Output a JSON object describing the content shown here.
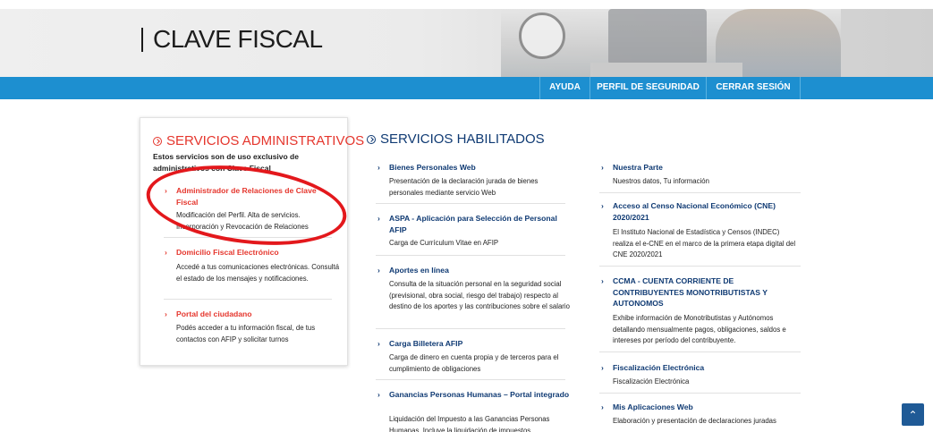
{
  "header": {
    "title": "CLAVE FISCAL"
  },
  "nav": {
    "items": [
      "AYUDA",
      "PERFIL DE SEGURIDAD",
      "CERRAR SESIÓN"
    ]
  },
  "admin": {
    "title": "SERVICIOS ADMINISTRATIVOS",
    "description": "Estos servicios son de uso exclusivo de administrativos con Clave Fiscal",
    "items": [
      {
        "title": "Administrador de Relaciones de Clave Fiscal",
        "desc": "Modificación del Perfil. Alta de servicios. Incorporación y Revocación de Relaciones"
      },
      {
        "title": "Domicilio Fiscal Electrónico",
        "desc": "Accedé a tus comunicaciones electrónicas. Consultá el estado de los mensajes y notificaciones."
      },
      {
        "title": "Portal del ciudadano",
        "desc": "Podés acceder a tu información fiscal, de tus contactos con AFIP y solicitar turnos"
      }
    ]
  },
  "habilitados": {
    "title": "SERVICIOS HABILITADOS",
    "col1": [
      {
        "title": "Bienes Personales Web",
        "desc": "Presentación de la declaración jurada de bienes personales mediante servicio Web"
      },
      {
        "title": "ASPA - Aplicación para Selección de Personal AFIP",
        "desc": "Carga de Currículum Vitae en AFIP"
      },
      {
        "title": "Aportes en línea",
        "desc": "Consulta de la situación personal en la seguridad social (previsional, obra social, riesgo del trabajo) respecto al destino de los aportes y las contribuciones sobre el salario"
      },
      {
        "title": "Carga Billetera AFIP",
        "desc": "Carga de dinero en cuenta propia y de terceros para el cumplimiento de obligaciones"
      },
      {
        "title": "Ganancias Personas Humanas – Portal integrado",
        "desc": "Liquidación del Impuesto a las Ganancias Personas Humanas. Incluye la liquidación de impuestos"
      }
    ],
    "col2": [
      {
        "title": "Nuestra Parte",
        "desc": "Nuestros datos, Tu información"
      },
      {
        "title": "Acceso al Censo Nacional Económico (CNE) 2020/2021",
        "desc": "El Instituto Nacional de Estadística y Censos (INDEC) realiza el e-CNE en el marco de la primera etapa digital del CNE 2020/2021"
      },
      {
        "title": "CCMA - CUENTA CORRIENTE DE CONTRIBUYENTES MONOTRIBUTISTAS Y AUTONOMOS",
        "desc": "Exhibe información de Monotributistas y Autónomos detallando mensualmente pagos, obligaciones, saldos e intereses por período del contribuyente."
      },
      {
        "title": "Fiscalización Electrónica",
        "desc": "Fiscalización Electrónica"
      },
      {
        "title": "Mis Aplicaciones Web",
        "desc": "Elaboración y presentación de declaraciones juradas"
      }
    ]
  },
  "colors": {
    "nav_blue": "#1d8fd0",
    "accent_red": "#e5362d",
    "link_blue": "#0f3a73",
    "annotation_red": "#e3181c"
  },
  "icons": {
    "section": "circle-chevron-icon",
    "item": "chevron-right-icon",
    "scroll_top": "chevron-up-icon"
  }
}
